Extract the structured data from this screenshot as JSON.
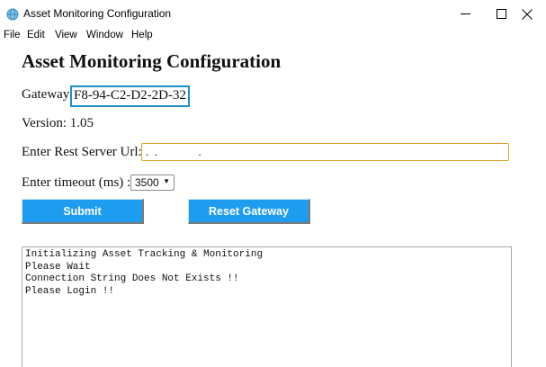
{
  "window": {
    "title": "Asset Monitoring Configuration",
    "controls": {
      "minimize": "–",
      "maximize": "☐",
      "close": "✕"
    }
  },
  "menu": [
    "File",
    "Edit",
    "View",
    "Window",
    "Help"
  ],
  "page": {
    "title": "Asset Monitoring Configuration",
    "gateway_label": "Gateway:",
    "gateway_value": "F8-94-C2-D2-2D-32",
    "version_label": "Version: 1.05",
    "url_label": "Enter Rest Server Url:",
    "url_value": ".  .              .",
    "timeout_label": "Enter timeout (ms) :",
    "timeout_value": "3500",
    "submit_label": "Submit",
    "reset_label": "Reset Gateway"
  },
  "log": [
    "Initializing Asset Tracking & Monitoring",
    "Please Wait",
    "Connection String Does Not Exists !!",
    "Please Login !!"
  ],
  "colors": {
    "button_bg": "#1e9cf0",
    "gateway_border": "#1e90c8",
    "url_border": "#e0a030"
  }
}
